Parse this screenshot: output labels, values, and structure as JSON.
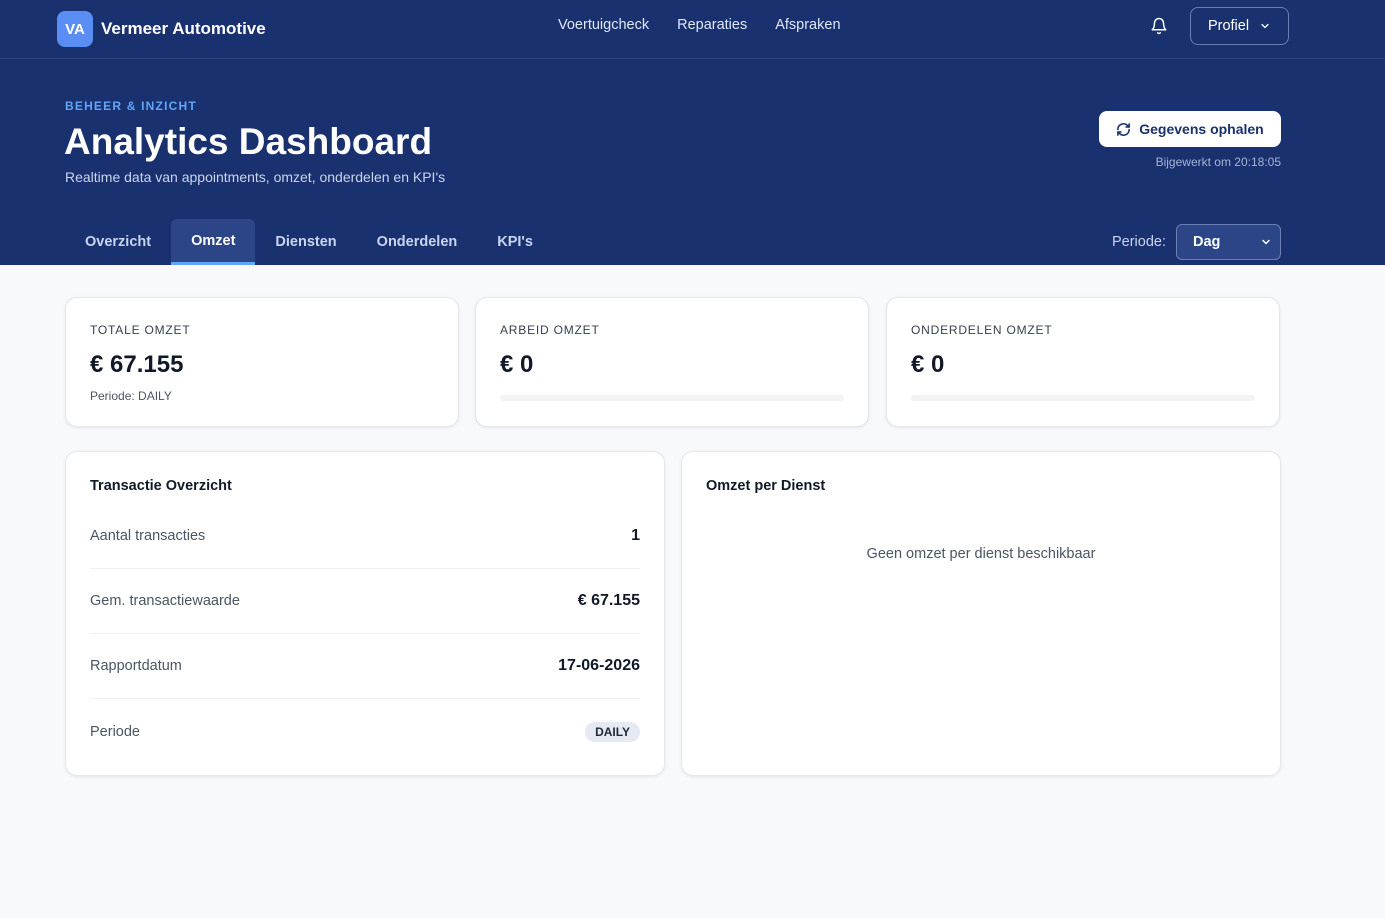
{
  "brand": {
    "logo": "VA",
    "name": "Vermeer Automotive"
  },
  "nav": [
    "Voertuigcheck",
    "Reparaties",
    "Afspraken"
  ],
  "profile": {
    "label": "Profiel"
  },
  "hero": {
    "eyebrow": "BEHEER & INZICHT",
    "title": "Analytics Dashboard",
    "subtitle": "Realtime data van appointments, omzet, onderdelen en KPI's",
    "refresh_label": "Gegevens ophalen",
    "updated": "Bijgewerkt om 20:18:05"
  },
  "tabs": [
    "Overzicht",
    "Omzet",
    "Diensten",
    "Onderdelen",
    "KPI's"
  ],
  "active_tab": "Omzet",
  "period": {
    "label": "Periode:",
    "selected": "Dag"
  },
  "kpis": [
    {
      "label": "TOTALE OMZET",
      "value": "€ 67.155",
      "note": "Periode: DAILY"
    },
    {
      "label": "ARBEID OMZET",
      "value": "€ 0",
      "progress": 0
    },
    {
      "label": "ONDERDELEN OMZET",
      "value": "€ 0",
      "progress": 0
    }
  ],
  "transactions": {
    "title": "Transactie Overzicht",
    "rows": [
      {
        "label": "Aantal transacties",
        "value": "1"
      },
      {
        "label": "Gem. transactiewaarde",
        "value": "€ 67.155"
      },
      {
        "label": "Rapportdatum",
        "value": "17-06-2026"
      },
      {
        "label": "Periode",
        "value": "DAILY"
      }
    ]
  },
  "service_revenue": {
    "title": "Omzet per Dienst",
    "empty": "Geen omzet per dienst beschikbaar"
  },
  "colors": {
    "primary": "#1a3170",
    "accent": "#60a5fa"
  }
}
